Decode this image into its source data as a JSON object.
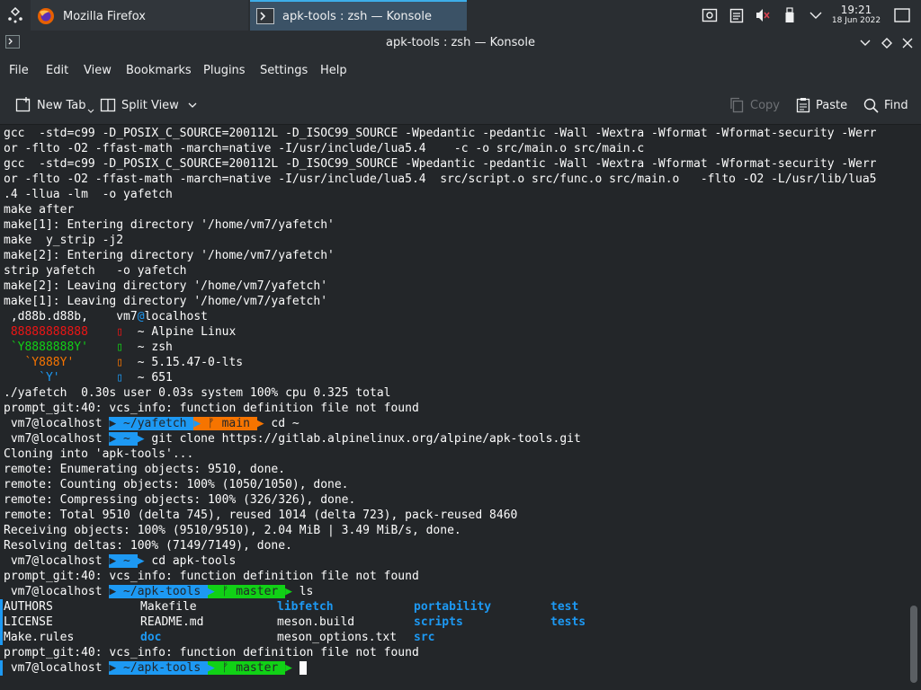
{
  "taskbar": {
    "tasks": [
      {
        "label": "Mozilla Firefox",
        "icon": "firefox-icon"
      },
      {
        "label": "apk-tools : zsh — Konsole",
        "icon": "konsole-icon"
      }
    ],
    "clock": {
      "time": "19:21",
      "date": "18 Jun 2022"
    }
  },
  "window": {
    "title": "apk-tools : zsh — Konsole"
  },
  "menu": [
    "File",
    "Edit",
    "View",
    "Bookmarks",
    "Plugins",
    "Settings",
    "Help"
  ],
  "toolbar": {
    "new_tab": "New Tab",
    "split_view": "Split View",
    "copy": "Copy",
    "paste": "Paste",
    "find": "Find"
  },
  "colors": {
    "accent": "#1d99f3",
    "git_orange": "#f67400",
    "git_green": "#11d116",
    "logo_red": "#ed1515",
    "logo_green": "#11d116",
    "logo_orange": "#f67400",
    "logo_blue": "#1d99f3"
  },
  "terminal": {
    "lines": [
      "gcc  -std=c99 -D_POSIX_C_SOURCE=200112L -D_ISOC99_SOURCE -Wpedantic -pedantic -Wall -Wextra -Wformat -Wformat-security -Werr",
      "or -flto -O2 -ffast-math -march=native -I/usr/include/lua5.4    -c -o src/main.o src/main.c",
      "gcc  -std=c99 -D_POSIX_C_SOURCE=200112L -D_ISOC99_SOURCE -Wpedantic -pedantic -Wall -Wextra -Wformat -Wformat-security -Werr",
      "or -flto -O2 -ffast-math -march=native -I/usr/include/lua5.4  src/script.o src/func.o src/main.o   -flto -O2 -L/usr/lib/lua5",
      ".4 -llua -lm  -o yafetch",
      "make after",
      "make[1]: Entering directory '/home/vm7/yafetch'",
      "make  y_strip -j2",
      "make[2]: Entering directory '/home/vm7/yafetch'",
      "strip yafetch   -o yafetch",
      "make[2]: Leaving directory '/home/vm7/yafetch'",
      "make[1]: Leaving directory '/home/vm7/yafetch'"
    ],
    "fetch": {
      "logo": [
        " ,d88b.d88b,",
        " 88888888888",
        " `Y8888888Y'",
        "   `Y888Y'",
        "     `Y'"
      ],
      "user": "vm7",
      "at": "@",
      "host": "localhost",
      "rows": [
        {
          "label": "~",
          "value": "Alpine Linux"
        },
        {
          "label": "~",
          "value": "zsh"
        },
        {
          "label": "~",
          "value": "5.15.47-0-lts"
        },
        {
          "label": "~",
          "value": "651"
        }
      ]
    },
    "timing": "./yafetch  0.30s user 0.03s system 100% cpu 0.325 total",
    "prompt_err": "prompt_git:40: vcs_info: function definition file not found",
    "prompt_host": " vm7@localhost ",
    "p1": {
      "dir": " ~/yafetch ",
      "branch": " ᚠ main ",
      "cmd": "cd ~"
    },
    "p2": {
      "dir": " ~ ",
      "cmd": "git clone https://gitlab.alpinelinux.org/alpine/apk-tools.git"
    },
    "clone": [
      "Cloning into 'apk-tools'...",
      "remote: Enumerating objects: 9510, done.",
      "remote: Counting objects: 100% (1050/1050), done.",
      "remote: Compressing objects: 100% (326/326), done.",
      "remote: Total 9510 (delta 745), reused 1014 (delta 723), pack-reused 8460",
      "Receiving objects: 100% (9510/9510), 2.04 MiB | 3.49 MiB/s, done.",
      "Resolving deltas: 100% (7149/7149), done."
    ],
    "p3": {
      "dir": " ~ ",
      "cmd": "cd apk-tools"
    },
    "p4": {
      "dir": " ~/apk-tools ",
      "branch": " ᚠ master ",
      "cmd": "ls"
    },
    "ls": [
      [
        {
          "t": "AUTHORS",
          "d": false
        },
        {
          "t": "Makefile",
          "d": false
        },
        {
          "t": "libfetch",
          "d": true
        },
        {
          "t": "portability",
          "d": true
        },
        {
          "t": "test",
          "d": true
        }
      ],
      [
        {
          "t": "LICENSE",
          "d": false
        },
        {
          "t": "README.md",
          "d": false
        },
        {
          "t": "meson.build",
          "d": false
        },
        {
          "t": "scripts",
          "d": true
        },
        {
          "t": "tests",
          "d": true
        }
      ],
      [
        {
          "t": "Make.rules",
          "d": false
        },
        {
          "t": "doc",
          "d": true
        },
        {
          "t": "meson_options.txt",
          "d": false
        },
        {
          "t": "src",
          "d": true
        }
      ]
    ],
    "p5": {
      "dir": " ~/apk-tools ",
      "branch": " ᚠ master "
    }
  }
}
